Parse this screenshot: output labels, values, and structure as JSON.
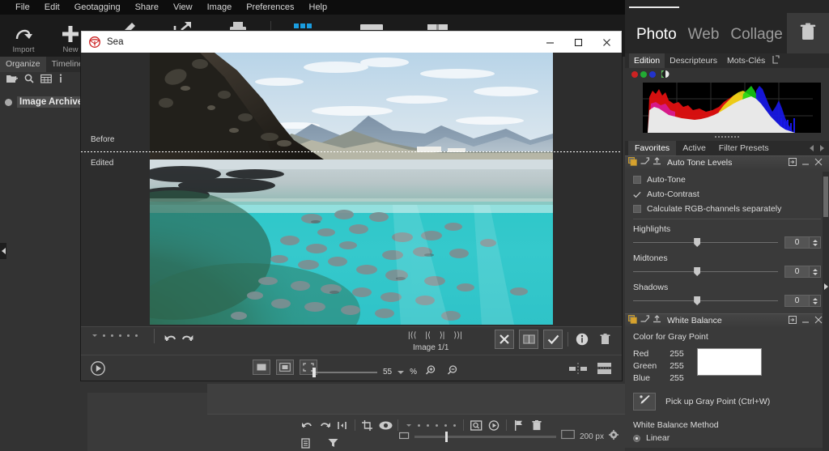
{
  "menu": {
    "items": [
      "File",
      "Edit",
      "Geotagging",
      "Share",
      "View",
      "Image",
      "Preferences",
      "Help"
    ]
  },
  "toolbar": {
    "buttons": [
      {
        "label": "Import",
        "icon": "import-arrow-icon"
      },
      {
        "label": "New",
        "icon": "plus-icon"
      }
    ],
    "tools": [
      {
        "icon": "edit-pencil-icon"
      },
      {
        "icon": "share-export-icon"
      },
      {
        "icon": "print-icon"
      },
      {
        "icon": "grid-view-icon",
        "active": true
      },
      {
        "icon": "single-view-icon"
      },
      {
        "icon": "book-view-icon"
      }
    ]
  },
  "left_panel": {
    "tabs": [
      {
        "label": "Organize",
        "active": true
      },
      {
        "label": "Timeline",
        "active": false
      }
    ],
    "icons": [
      "add-folder-icon",
      "search-icon",
      "calendar-icon",
      "info-icon"
    ],
    "tree": [
      {
        "label": "Image Archive"
      }
    ]
  },
  "viewer": {
    "title": "Sea",
    "title_icon": "parachute-icon",
    "window_buttons": {
      "minimize": "–",
      "maximize": "□",
      "close": "✕"
    },
    "before_label": "Before",
    "edited_label": "Edited",
    "image_count": "Image 1/1",
    "nav_buttons": [
      "|⟨⟨",
      "|⟨",
      "⟩|",
      "⟩⟩|"
    ],
    "action_icons": [
      "reject-cross-icon",
      "compare-icon",
      "approve-check-icon",
      "info-icon",
      "delete-icon"
    ],
    "undo_icon": "undo-icon",
    "redo_icon": "redo-icon",
    "play_icon": "slideshow-play-icon",
    "fit_icons": [
      "fit-window-icon",
      "fit-actual-icon",
      "fit-screen-icon"
    ],
    "zoom_value": "55",
    "zoom_unit": "%",
    "zoom_in_icon": "zoom-in-icon",
    "zoom_out_icon": "zoom-out-icon",
    "split_icons": [
      "split-horizontal-icon",
      "split-vertical-icon"
    ]
  },
  "right_panel": {
    "modes": [
      {
        "label": "Photo",
        "active": true
      },
      {
        "label": "Web",
        "active": false
      },
      {
        "label": "Collage",
        "active": false
      }
    ],
    "trash_icon": "trash-icon",
    "tabs": [
      {
        "label": "Edition",
        "active": true
      },
      {
        "label": "Descripteurs",
        "active": false
      },
      {
        "label": "Mots-Clés",
        "active": false
      }
    ],
    "tab_detach_icon": "detach-panel-icon",
    "histogram_channels": [
      {
        "name": "red-channel-dot",
        "color": "#cc2222"
      },
      {
        "name": "green-channel-dot",
        "color": "#22aa33"
      },
      {
        "name": "blue-channel-dot",
        "color": "#2233cc"
      },
      {
        "name": "luminance-toggle-icon",
        "color": "#dddddd"
      }
    ],
    "filter_tabs": [
      {
        "label": "Favorites",
        "active": true
      },
      {
        "label": "Active",
        "active": false
      },
      {
        "label": "Filter Presets",
        "active": false
      }
    ],
    "filters": [
      {
        "title": "Auto Tone Levels",
        "header_icons": [
          "copy-settings-icon",
          "paste-settings-icon",
          "save-preset-icon"
        ],
        "right_icons": [
          "expand-icon",
          "minimize-icon",
          "close-icon"
        ],
        "checkboxes": [
          {
            "label": "Auto-Tone",
            "checked": false
          },
          {
            "label": "Auto-Contrast",
            "checked": true
          },
          {
            "label": "Calculate RGB-channels separately",
            "checked": false
          }
        ],
        "sliders": [
          {
            "label": "Highlights",
            "value": "0"
          },
          {
            "label": "Midtones",
            "value": "0"
          },
          {
            "label": "Shadows",
            "value": "0"
          }
        ]
      },
      {
        "title": "White Balance",
        "header_icons": [
          "copy-settings-icon",
          "paste-settings-icon",
          "save-preset-icon"
        ],
        "right_icons": [
          "expand-icon",
          "minimize-icon",
          "close-icon"
        ],
        "section_label": "Color for Gray Point",
        "channels": [
          {
            "label": "Red",
            "value": "255"
          },
          {
            "label": "Green",
            "value": "255"
          },
          {
            "label": "Blue",
            "value": "255"
          }
        ],
        "swatch_color": "#ffffff",
        "pick_label": "Pick up Gray Point (Ctrl+W)",
        "pick_icon": "eyedropper-icon",
        "method_label": "White Balance Method",
        "methods": [
          {
            "label": "Linear",
            "selected": true
          }
        ]
      }
    ]
  },
  "bottom_bar": {
    "row1_icons": [
      "undo-icon",
      "redo-icon",
      "rotate-icon",
      "crop-icon",
      "preview-eye-icon",
      "rating-dots-icon",
      "find-icon",
      "timer-icon",
      "flag-icon",
      "delete-icon"
    ],
    "row2_icons": [
      "list-view-icon",
      "filter-icon"
    ],
    "thumb_size_value": "200 px",
    "thumb_small_icon": "small-thumb-icon",
    "thumb_large_icon": "large-thumb-icon",
    "settings_icon": "gear-icon"
  },
  "colors": {
    "accent_blue": "#1a9de0",
    "panel_bg": "#333333",
    "toolbar_bg": "#1b1b1b",
    "menu_bg": "#0d0d0d",
    "title_bg": "#ffffff"
  }
}
